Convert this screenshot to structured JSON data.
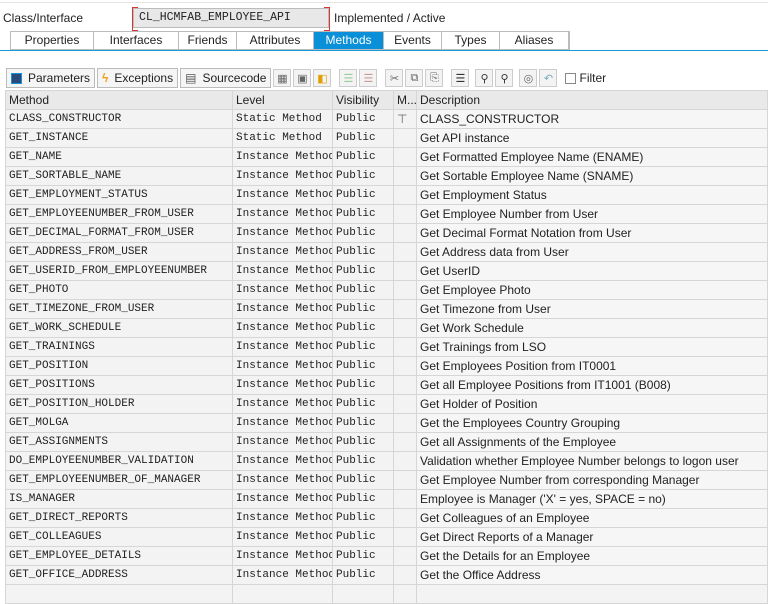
{
  "header": {
    "label": "Class/Interface",
    "class_name": "CL_HCMFAB_EMPLOYEE_API",
    "status": "Implemented / Active"
  },
  "tabs": [
    {
      "label": "Properties",
      "active": false
    },
    {
      "label": "Interfaces",
      "active": false
    },
    {
      "label": "Friends",
      "active": false
    },
    {
      "label": "Attributes",
      "active": false
    },
    {
      "label": "Methods",
      "active": true
    },
    {
      "label": "Events",
      "active": false
    },
    {
      "label": "Types",
      "active": false
    },
    {
      "label": "Aliases",
      "active": false
    }
  ],
  "toolbar": {
    "parameters": "Parameters",
    "exceptions": "Exceptions",
    "sourcecode": "Sourcecode",
    "filter": "Filter"
  },
  "columns": [
    "Method",
    "Level",
    "Visibility",
    "M...",
    "Description"
  ],
  "rows": [
    [
      "CLASS_CONSTRUCTOR",
      "Static Method",
      "Public",
      "CLASS_CONSTRUCTOR"
    ],
    [
      "GET_INSTANCE",
      "Static Method",
      "Public",
      "Get API instance"
    ],
    [
      "GET_NAME",
      "Instance Method",
      "Public",
      "Get Formatted Employee Name (ENAME)"
    ],
    [
      "GET_SORTABLE_NAME",
      "Instance Method",
      "Public",
      "Get Sortable Employee Name (SNAME)"
    ],
    [
      "GET_EMPLOYMENT_STATUS",
      "Instance Method",
      "Public",
      "Get Employment Status"
    ],
    [
      "GET_EMPLOYEENUMBER_FROM_USER",
      "Instance Method",
      "Public",
      "Get Employee Number from User"
    ],
    [
      "GET_DECIMAL_FORMAT_FROM_USER",
      "Instance Method",
      "Public",
      "Get Decimal Format Notation from User"
    ],
    [
      "GET_ADDRESS_FROM_USER",
      "Instance Method",
      "Public",
      "Get Address data from User"
    ],
    [
      "GET_USERID_FROM_EMPLOYEENUMBER",
      "Instance Method",
      "Public",
      "Get UserID"
    ],
    [
      "GET_PHOTO",
      "Instance Method",
      "Public",
      "Get Employee Photo"
    ],
    [
      "GET_TIMEZONE_FROM_USER",
      "Instance Method",
      "Public",
      "Get Timezone from User"
    ],
    [
      "GET_WORK_SCHEDULE",
      "Instance Method",
      "Public",
      "Get Work Schedule"
    ],
    [
      "GET_TRAININGS",
      "Instance Method",
      "Public",
      "Get Trainings from LSO"
    ],
    [
      "GET_POSITION",
      "Instance Method",
      "Public",
      "Get Employees Position from IT0001"
    ],
    [
      "GET_POSITIONS",
      "Instance Method",
      "Public",
      "Get all Employee Positions from IT1001 (B008)"
    ],
    [
      "GET_POSITION_HOLDER",
      "Instance Method",
      "Public",
      "Get Holder of Position"
    ],
    [
      "GET_MOLGA",
      "Instance Method",
      "Public",
      "Get the Employees Country Grouping"
    ],
    [
      "GET_ASSIGNMENTS",
      "Instance Method",
      "Public",
      "Get all Assignments of the Employee"
    ],
    [
      "DO_EMPLOYEENUMBER_VALIDATION",
      "Instance Method",
      "Public",
      "Validation whether Employee Number belongs to logon user"
    ],
    [
      "GET_EMPLOYEENUMBER_OF_MANAGER",
      "Instance Method",
      "Public",
      "Get Employee Number from corresponding Manager"
    ],
    [
      "IS_MANAGER",
      "Instance Method",
      "Public",
      "Employee is Manager ('X' = yes, SPACE = no)"
    ],
    [
      "GET_DIRECT_REPORTS",
      "Instance Method",
      "Public",
      "Get Colleagues of an Employee"
    ],
    [
      "GET_COLLEAGUES",
      "Instance Method",
      "Public",
      "Get Direct Reports of a Manager"
    ],
    [
      "GET_EMPLOYEE_DETAILS",
      "Instance Method",
      "Public",
      "Get the Details for an Employee"
    ],
    [
      "GET_OFFICE_ADDRESS",
      "Instance Method",
      "Public",
      "Get the Office Address"
    ]
  ]
}
